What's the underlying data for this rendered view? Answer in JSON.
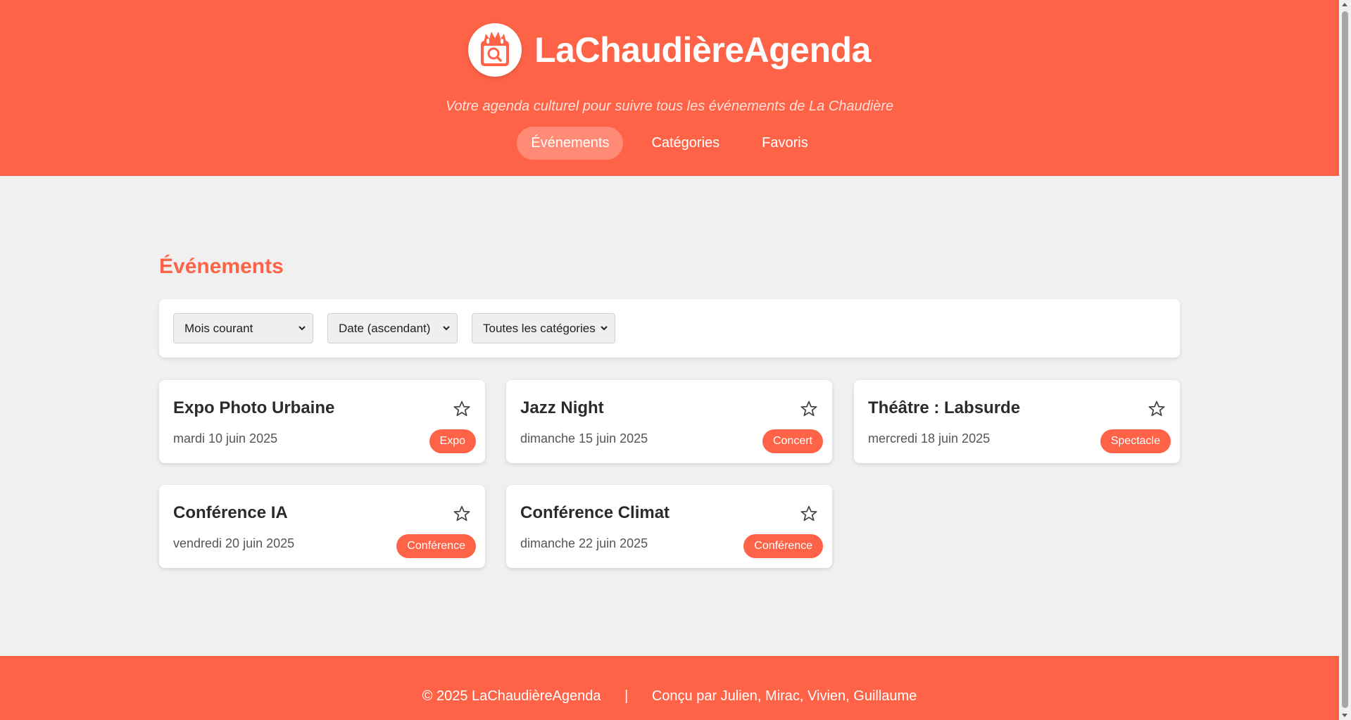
{
  "header": {
    "title": "LaChaudièreAgenda",
    "tagline": "Votre agenda culturel pour suivre tous les événements de La Chaudière",
    "nav": [
      "Événements",
      "Catégories",
      "Favoris"
    ],
    "active_nav": "Événements",
    "logo_icon": "calendar-flame-search-icon"
  },
  "main": {
    "section_title": "Événements",
    "filters": {
      "period": "Mois courant",
      "sort": "Date (ascendant)",
      "category": "Toutes les catégories"
    },
    "events": [
      {
        "title": "Expo Photo Urbaine",
        "date": "mardi 10 juin 2025",
        "category": "Expo"
      },
      {
        "title": "Jazz Night",
        "date": "dimanche 15 juin 2025",
        "category": "Concert"
      },
      {
        "title": "Théâtre : Labsurde",
        "date": "mercredi 18 juin 2025",
        "category": "Spectacle"
      },
      {
        "title": "Conférence IA",
        "date": "vendredi 20 juin 2025",
        "category": "Conférence"
      },
      {
        "title": "Conférence Climat",
        "date": "dimanche 22 juin 2025",
        "category": "Conférence"
      }
    ]
  },
  "footer": {
    "copyright": "© 2025 LaChaudièreAgenda",
    "separator": "|",
    "credits": "Conçu par Julien, Mirac, Vivien, Guillaume"
  },
  "colors": {
    "accent": "#ff6347",
    "background": "#f0f0f0"
  }
}
